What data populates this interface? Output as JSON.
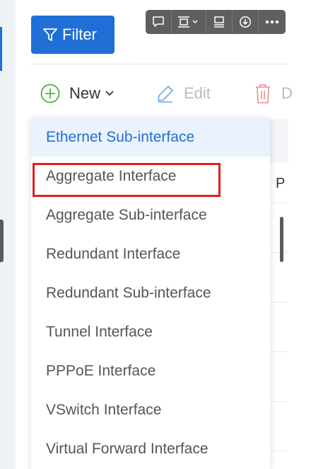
{
  "toolbar": {
    "filter_label": "Filter",
    "new_label": "New",
    "edit_label": "Edit",
    "delete_label": "D"
  },
  "floating_toolbar": {
    "buttons": [
      "comment-icon",
      "layout-icon",
      "align-icon",
      "download-icon",
      "more-icon"
    ]
  },
  "table": {
    "column_header": "P"
  },
  "dropdown": {
    "items": [
      "Ethernet Sub-interface",
      "Aggregate Interface",
      "Aggregate Sub-interface",
      "Redundant Interface",
      "Redundant Sub-interface",
      "Tunnel Interface",
      "PPPoE Interface",
      "VSwitch Interface",
      "Virtual Forward Interface"
    ],
    "active_item": "Ethernet Sub-interface",
    "highlighted_item": "Aggregate Interface"
  },
  "colors": {
    "primary": "#1f6fd6",
    "new_icon": "#52b043",
    "delete_icon": "#f08c8c",
    "highlight": "#e02020"
  }
}
